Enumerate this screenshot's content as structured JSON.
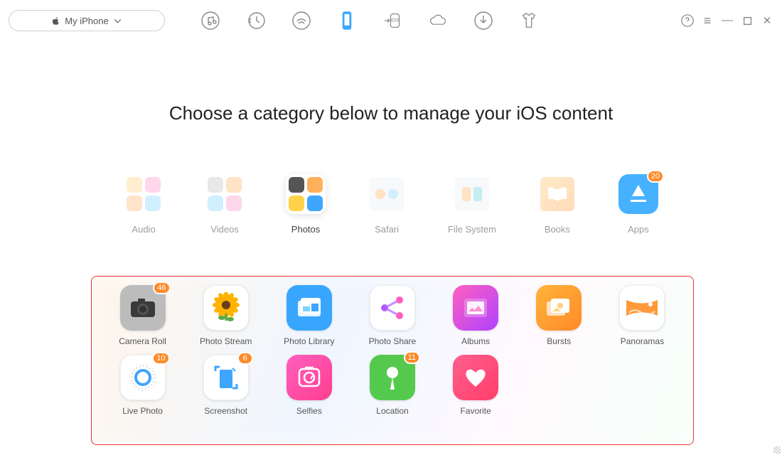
{
  "header": {
    "device_label": "My iPhone"
  },
  "main": {
    "title": "Choose a category below to manage your iOS content",
    "categories": [
      {
        "label": "Audio"
      },
      {
        "label": "Videos"
      },
      {
        "label": "Photos"
      },
      {
        "label": "Safari"
      },
      {
        "label": "File System"
      },
      {
        "label": "Books"
      },
      {
        "label": "Apps",
        "badge": 20
      }
    ],
    "selected_category": "Photos",
    "photos_panel": {
      "items": [
        {
          "label": "Camera Roll",
          "badge": 46,
          "bg": "#bcbcbc",
          "icon": "camera"
        },
        {
          "label": "Photo Stream",
          "bg": "#fff",
          "icon": "sunflower"
        },
        {
          "label": "Photo Library",
          "bg": "#38a6ff",
          "icon": "library"
        },
        {
          "label": "Photo Share",
          "bg": "#fff",
          "icon": "share"
        },
        {
          "label": "Albums",
          "bg": "linear-gradient(135deg,#ff5fbf,#b042ff)",
          "icon": "gallery"
        },
        {
          "label": "Bursts",
          "bg": "linear-gradient(135deg,#ffb43a,#ff8a2a)",
          "icon": "bursts"
        },
        {
          "label": "Panoramas",
          "bg": "#fff",
          "icon": "panorama"
        },
        {
          "label": "Live Photo",
          "badge": 10,
          "bg": "#fff",
          "icon": "live"
        },
        {
          "label": "Screenshot",
          "badge": 6,
          "bg": "#fff",
          "icon": "screenshot"
        },
        {
          "label": "Selfies",
          "bg": "linear-gradient(135deg,#ff5fbf,#ff3e8f)",
          "icon": "selfie"
        },
        {
          "label": "Location",
          "badge": 11,
          "bg": "#55c94d",
          "icon": "pin"
        },
        {
          "label": "Favorite",
          "bg": "linear-gradient(135deg,#ff5f8f,#ff3e6a)",
          "icon": "heart"
        }
      ]
    }
  },
  "colors": {
    "accent": "#3ea6ff",
    "badge": "#ff8a2a",
    "panel_border": "#e33"
  }
}
